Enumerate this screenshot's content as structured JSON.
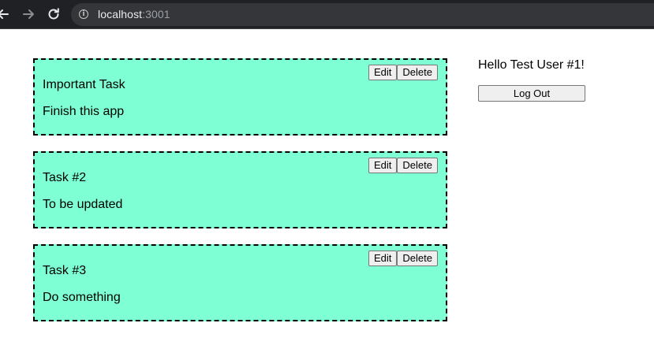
{
  "browser": {
    "url_host": "localhost",
    "url_port": ":3001"
  },
  "tasks": [
    {
      "title": "Important Task",
      "description": "Finish this app",
      "edit_label": "Edit",
      "delete_label": "Delete"
    },
    {
      "title": "Task #2",
      "description": "To be updated",
      "edit_label": "Edit",
      "delete_label": "Delete"
    },
    {
      "title": "Task #3",
      "description": "Do something",
      "edit_label": "Edit",
      "delete_label": "Delete"
    }
  ],
  "sidebar": {
    "greeting": "Hello Test User #1!",
    "logout_label": "Log Out"
  },
  "colors": {
    "task_background": "#7fffd4",
    "chrome_background": "#202124"
  },
  "icons": {
    "back": "arrow-left-icon",
    "forward": "arrow-right-icon",
    "reload": "reload-icon",
    "info": "info-icon"
  }
}
